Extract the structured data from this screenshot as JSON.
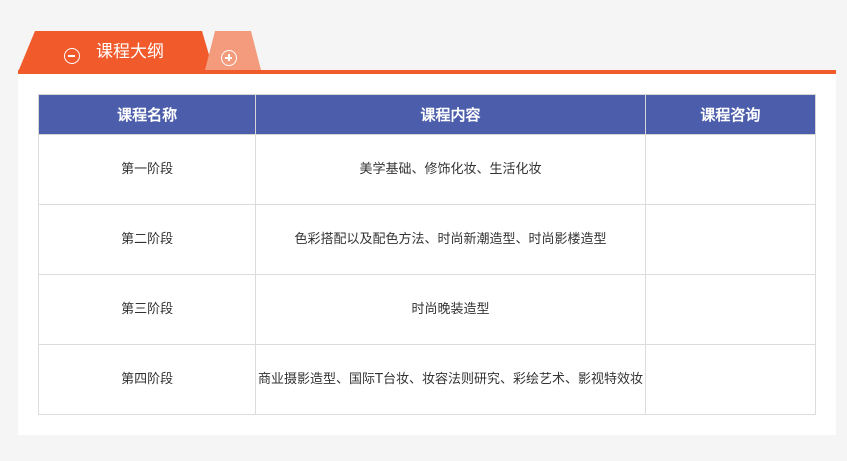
{
  "tabs": {
    "active_label": "课程大纲"
  },
  "table": {
    "headers": [
      "课程名称",
      "课程内容",
      "课程咨询"
    ],
    "rows": [
      {
        "name": "第一阶段",
        "content": "美学基础、修饰化妆、生活化妆",
        "consult": ""
      },
      {
        "name": "第二阶段",
        "content": "色彩搭配以及配色方法、时尚新潮造型、时尚影楼造型",
        "consult": ""
      },
      {
        "name": "第三阶段",
        "content": "时尚晚装造型",
        "consult": ""
      },
      {
        "name": "第四阶段",
        "content": "商业摄影造型、国际T台妆、妆容法则研究、彩绘艺术、影视特效妆",
        "consult": ""
      }
    ]
  },
  "colors": {
    "accent": "#f15a2b",
    "accent_light": "#f39b7c",
    "header_bg": "#4c5eab"
  },
  "icons": {
    "collapse": "minus-circle-icon",
    "expand": "plus-circle-icon"
  }
}
